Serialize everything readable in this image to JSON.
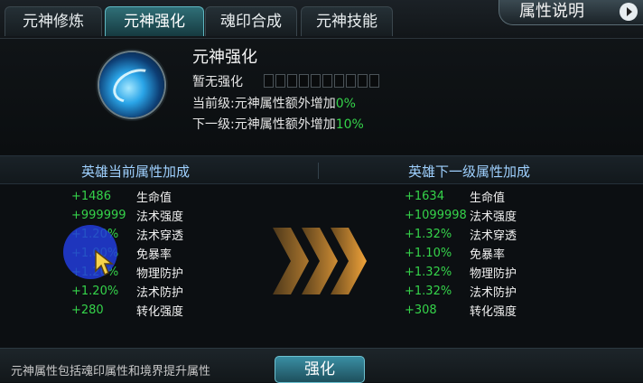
{
  "tabs": [
    {
      "label": "元神修炼",
      "active": false
    },
    {
      "label": "元神强化",
      "active": true
    },
    {
      "label": "魂印合成",
      "active": false
    },
    {
      "label": "元神技能",
      "active": false
    }
  ],
  "help_button": {
    "label": "属性说明"
  },
  "header": {
    "title": "元神强化",
    "status": "暂无强化",
    "level_slots": 10,
    "current_level": {
      "text": "当前级:元神属性额外增加",
      "value": "0%"
    },
    "next_level": {
      "text": "下一级:元神属性额外增加",
      "value": "10%"
    }
  },
  "compare": {
    "left_title": "英雄当前属性加成",
    "right_title": "英雄下一级属性加成"
  },
  "current_stats": [
    {
      "value": "+1486",
      "name": "生命值"
    },
    {
      "value": "+999999",
      "name": "法术强度"
    },
    {
      "value": "+1.20%",
      "name": "法术穿透"
    },
    {
      "value": "+1.00%",
      "name": "免暴率"
    },
    {
      "value": "+1.20%",
      "name": "物理防护"
    },
    {
      "value": "+1.20%",
      "name": "法术防护"
    },
    {
      "value": "+280",
      "name": "转化强度"
    }
  ],
  "next_stats": [
    {
      "value": "+1634",
      "name": "生命值"
    },
    {
      "value": "+1099998",
      "name": "法术强度"
    },
    {
      "value": "+1.32%",
      "name": "法术穿透"
    },
    {
      "value": "+1.10%",
      "name": "免暴率"
    },
    {
      "value": "+1.32%",
      "name": "物理防护"
    },
    {
      "value": "+1.32%",
      "name": "法术防护"
    },
    {
      "value": "+308",
      "name": "转化强度"
    }
  ],
  "footer": {
    "note": "元神属性包括魂印属性和境界提升属性",
    "button_label": "强化"
  }
}
